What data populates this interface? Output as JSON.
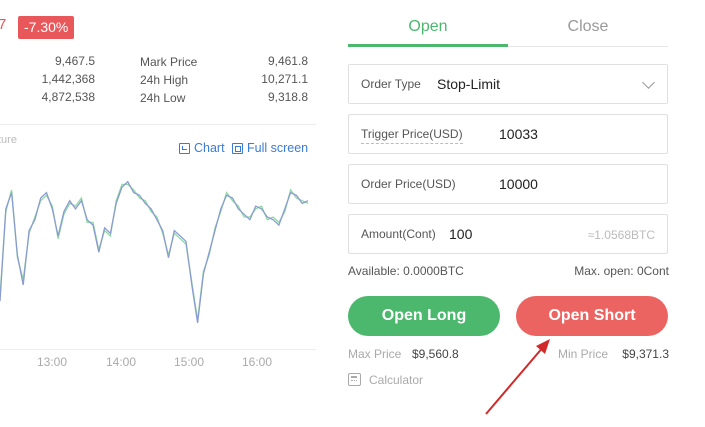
{
  "ticker": {
    "price_fragment": "7",
    "change_badge": "-7.30%"
  },
  "stats": {
    "left_values": [
      "9,467.5",
      "1,442,368",
      "4,872,538"
    ],
    "right_labels": [
      "Mark Price",
      "24h High",
      "24h Low"
    ],
    "right_values": [
      "9,461.8",
      "10,271.1",
      "9,318.8"
    ]
  },
  "chart_panel": {
    "label_fragment": "ture",
    "chart_link": "Chart",
    "fullscreen_link": "Full screen",
    "time_ticks": [
      "13:00",
      "14:00",
      "15:00",
      "16:00"
    ]
  },
  "chart_data": {
    "type": "line",
    "x": [
      "~12:20",
      "13:00",
      "14:00",
      "15:00",
      "16:00",
      "~16:30"
    ],
    "xlabel": "",
    "ylabel": "",
    "series": [
      {
        "values": [
          9390,
          9560,
          9590,
          9475,
          9420,
          9520,
          9540,
          9580,
          9590,
          9560,
          9510,
          9555,
          9575,
          9560,
          9575,
          9540,
          9530,
          9480,
          9525,
          9515,
          9570,
          9600,
          9610,
          9590,
          9585,
          9570,
          9560,
          9540,
          9520,
          9470,
          9520,
          9510,
          9500,
          9420,
          9350,
          9440,
          9480,
          9520,
          9560,
          9585,
          9580,
          9560,
          9550,
          9540,
          9565,
          9560,
          9545,
          9540,
          9530,
          9560,
          9590,
          9585,
          9570,
          9575
        ]
      },
      {
        "values": [
          9400,
          9555,
          9595,
          9470,
          9430,
          9515,
          9545,
          9575,
          9585,
          9565,
          9505,
          9550,
          9570,
          9565,
          9580,
          9535,
          9535,
          9485,
          9520,
          9510,
          9575,
          9605,
          9605,
          9595,
          9580,
          9575,
          9555,
          9545,
          9515,
          9475,
          9515,
          9505,
          9495,
          9425,
          9355,
          9445,
          9475,
          9525,
          9555,
          9590,
          9575,
          9565,
          9545,
          9545,
          9560,
          9565,
          9540,
          9545,
          9535,
          9555,
          9595,
          9580,
          9575,
          9570
        ]
      }
    ],
    "colors": [
      "#8a9ccf",
      "#8fd9a3"
    ]
  },
  "order_panel": {
    "tabs": [
      "Open",
      "Close"
    ],
    "order_type_label": "Order Type",
    "order_type_value": "Stop-Limit",
    "trigger_label": "Trigger Price(USD)",
    "trigger_value": "10033",
    "order_price_label": "Order Price(USD)",
    "order_price_value": "10000",
    "amount_label": "Amount(Cont)",
    "amount_value": "100",
    "amount_approx": "≈1.0568BTC",
    "available": "Available: 0.0000BTC",
    "max_open": "Max. open: 0Cont",
    "open_long": "Open Long",
    "open_short": "Open Short",
    "max_price_label": "Max Price",
    "max_price_value": "$9,560.8",
    "min_price_label": "Min Price",
    "min_price_value": "$9,371.3",
    "calculator": "Calculator"
  },
  "colors": {
    "buy": "#4cb86e",
    "sell": "#ec6461",
    "link": "#3a7bd5",
    "annotation_arrow": "#d12a2a"
  }
}
